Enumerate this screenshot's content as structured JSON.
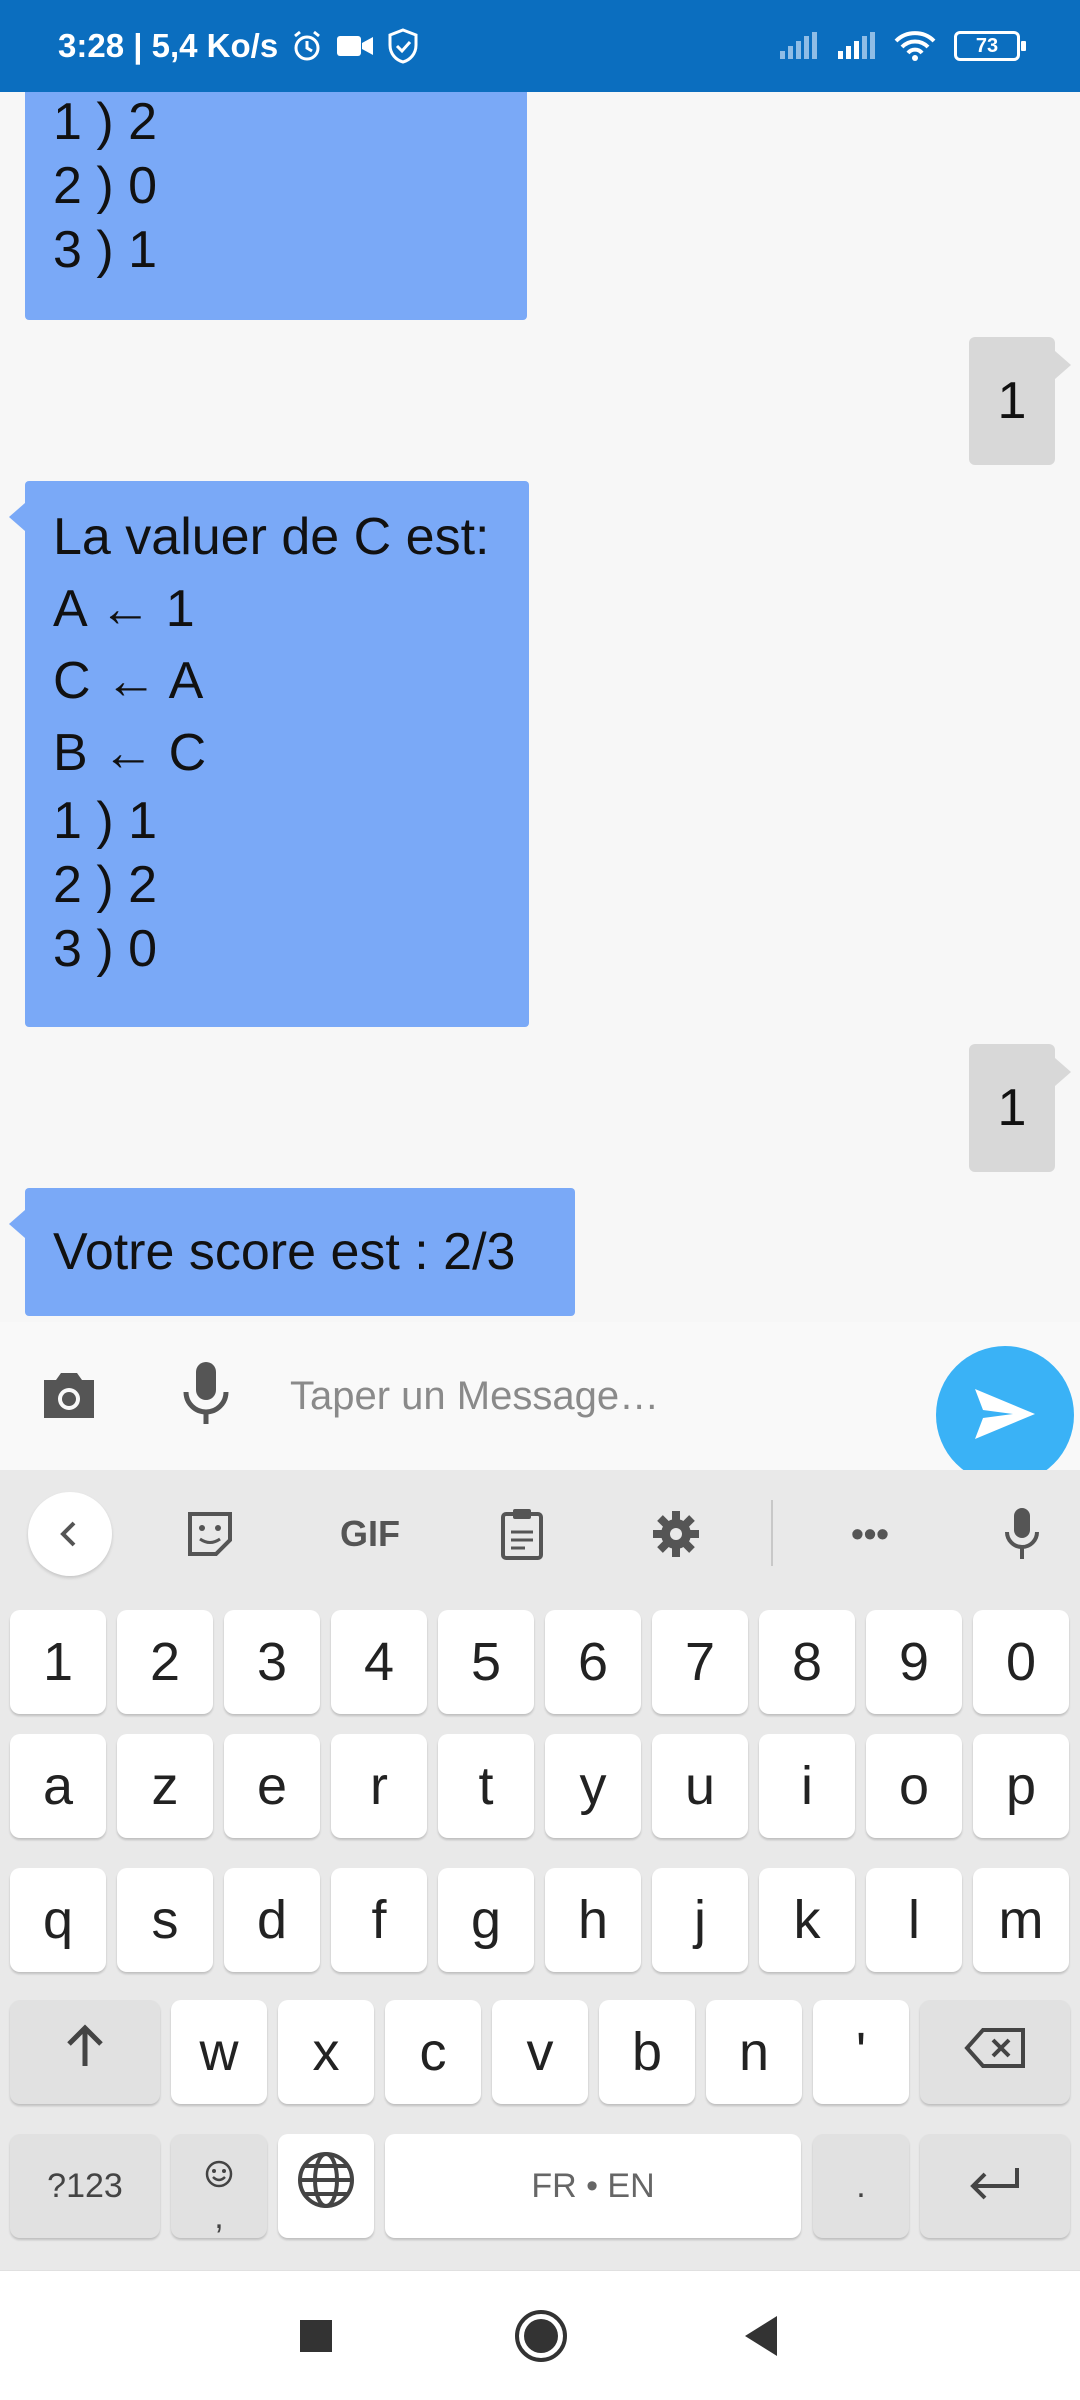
{
  "status_bar": {
    "time_speed": "3:28 | 5,4 Ko/s",
    "battery": "73"
  },
  "chat": {
    "bot_message_1": [
      "1 ) 2",
      "2 ) 0",
      "3 ) 1"
    ],
    "user_reply_1": "1",
    "bot_message_2": [
      "La valuer de C est:",
      "A ← 1",
      "C ← A",
      "B ← C",
      "1 ) 1",
      "2 ) 2",
      "3 ) 0"
    ],
    "user_reply_2": "1",
    "bot_message_3": "Votre score est : 2/3"
  },
  "composer": {
    "placeholder": "Taper un Message…"
  },
  "keyboard": {
    "toolbar": {
      "gif_label": "GIF",
      "more_label": "•••"
    },
    "row_numbers": [
      "1",
      "2",
      "3",
      "4",
      "5",
      "6",
      "7",
      "8",
      "9",
      "0"
    ],
    "row_1": [
      "a",
      "z",
      "e",
      "r",
      "t",
      "y",
      "u",
      "i",
      "o",
      "p"
    ],
    "row_2": [
      "q",
      "s",
      "d",
      "f",
      "g",
      "h",
      "j",
      "k",
      "l",
      "m"
    ],
    "row_3": [
      "w",
      "x",
      "c",
      "v",
      "b",
      "n",
      "'"
    ],
    "symbols_label": "?123",
    "emoji_comma_label": ",",
    "space_label": "FR • EN",
    "period_label": "."
  },
  "icons": {
    "status": [
      "alarm-icon",
      "video-camera-icon",
      "shield-icon",
      "signal-icon",
      "wifi-icon",
      "battery-icon"
    ],
    "composer": [
      "camera-icon",
      "microphone-icon",
      "send-icon"
    ],
    "toolbar": [
      "chevron-left-icon",
      "sticker-icon",
      "clipboard-icon",
      "gear-icon",
      "microphone-icon"
    ],
    "keyboard": [
      "shift-icon",
      "backspace-icon",
      "emoji-icon",
      "globe-icon",
      "enter-icon"
    ],
    "nav": [
      "recents-icon",
      "home-icon",
      "back-icon"
    ]
  },
  "colors": {
    "status_bar": "#0b6ebf",
    "bot_bubble": "#7aa9f7",
    "user_bubble": "#d8d8d8",
    "send_button": "#3ab2f6"
  }
}
